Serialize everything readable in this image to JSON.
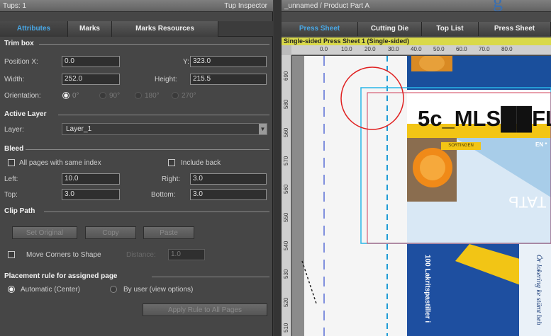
{
  "inspector": {
    "title": "Tups: 1",
    "subtitle": "Tup Inspector",
    "tabs": [
      "Attributes",
      "Marks",
      "Marks Resources"
    ],
    "trim_box": {
      "title": "Trim box",
      "position_x_label": "Position X:",
      "position_x": "0.0",
      "y_label": "Y:",
      "y": "323.0",
      "width_label": "Width:",
      "width": "252.0",
      "height_label": "Height:",
      "height": "215.5",
      "orientation_label": "Orientation:",
      "orientations": [
        "0°",
        "90°",
        "180°",
        "270°"
      ]
    },
    "active_layer": {
      "title": "Active Layer",
      "layer_label": "Layer:",
      "layer_value": "Layer_1"
    },
    "bleed": {
      "title": "Bleed",
      "all_pages_label": "All pages with same index",
      "include_back_label": "Include back",
      "left_label": "Left:",
      "left": "10.0",
      "right_label": "Right:",
      "right": "3.0",
      "top_label": "Top:",
      "top": "3.0",
      "bottom_label": "Bottom:",
      "bottom": "3.0"
    },
    "clip_path": {
      "title": "Clip Path",
      "set_original": "Set Original",
      "copy": "Copy",
      "paste": "Paste",
      "move_corners_label": "Move Corners to Shape",
      "distance_label": "Distance:",
      "distance": "1.0"
    },
    "placement": {
      "title": "Placement rule for assigned page",
      "automatic_label": "Automatic (Center)",
      "by_user_label": "By user (view options)",
      "apply_button": "Apply Rule to All Pages"
    }
  },
  "canvas": {
    "title": "_unnamed / Product Part A",
    "tabs": [
      "Press Sheet",
      "Cutting Die",
      "Top List",
      "Press Sheet"
    ],
    "status": "Single-sided   Press Sheet 1 (Single-sided)",
    "h_ruler": [
      "0.0",
      "10.0",
      "20.0",
      "30.0",
      "40.0",
      "50.0",
      "60.0",
      "70.0",
      "80.0"
    ],
    "v_ruler": [
      "690",
      "580",
      "560",
      "570",
      "560",
      "550",
      "540",
      "530",
      "520",
      "510"
    ],
    "product_text": "5c_MLS",
    "product_suffix": "FL",
    "badge_text": "SORTINGEN",
    "badge_right": "EN *",
    "side_text": "100 Lakritspastiller i",
    "italic_text": "Ör lokering ke stämt beh",
    "rotated_text": "ТАТЬ",
    "heading_fragment": "g"
  }
}
